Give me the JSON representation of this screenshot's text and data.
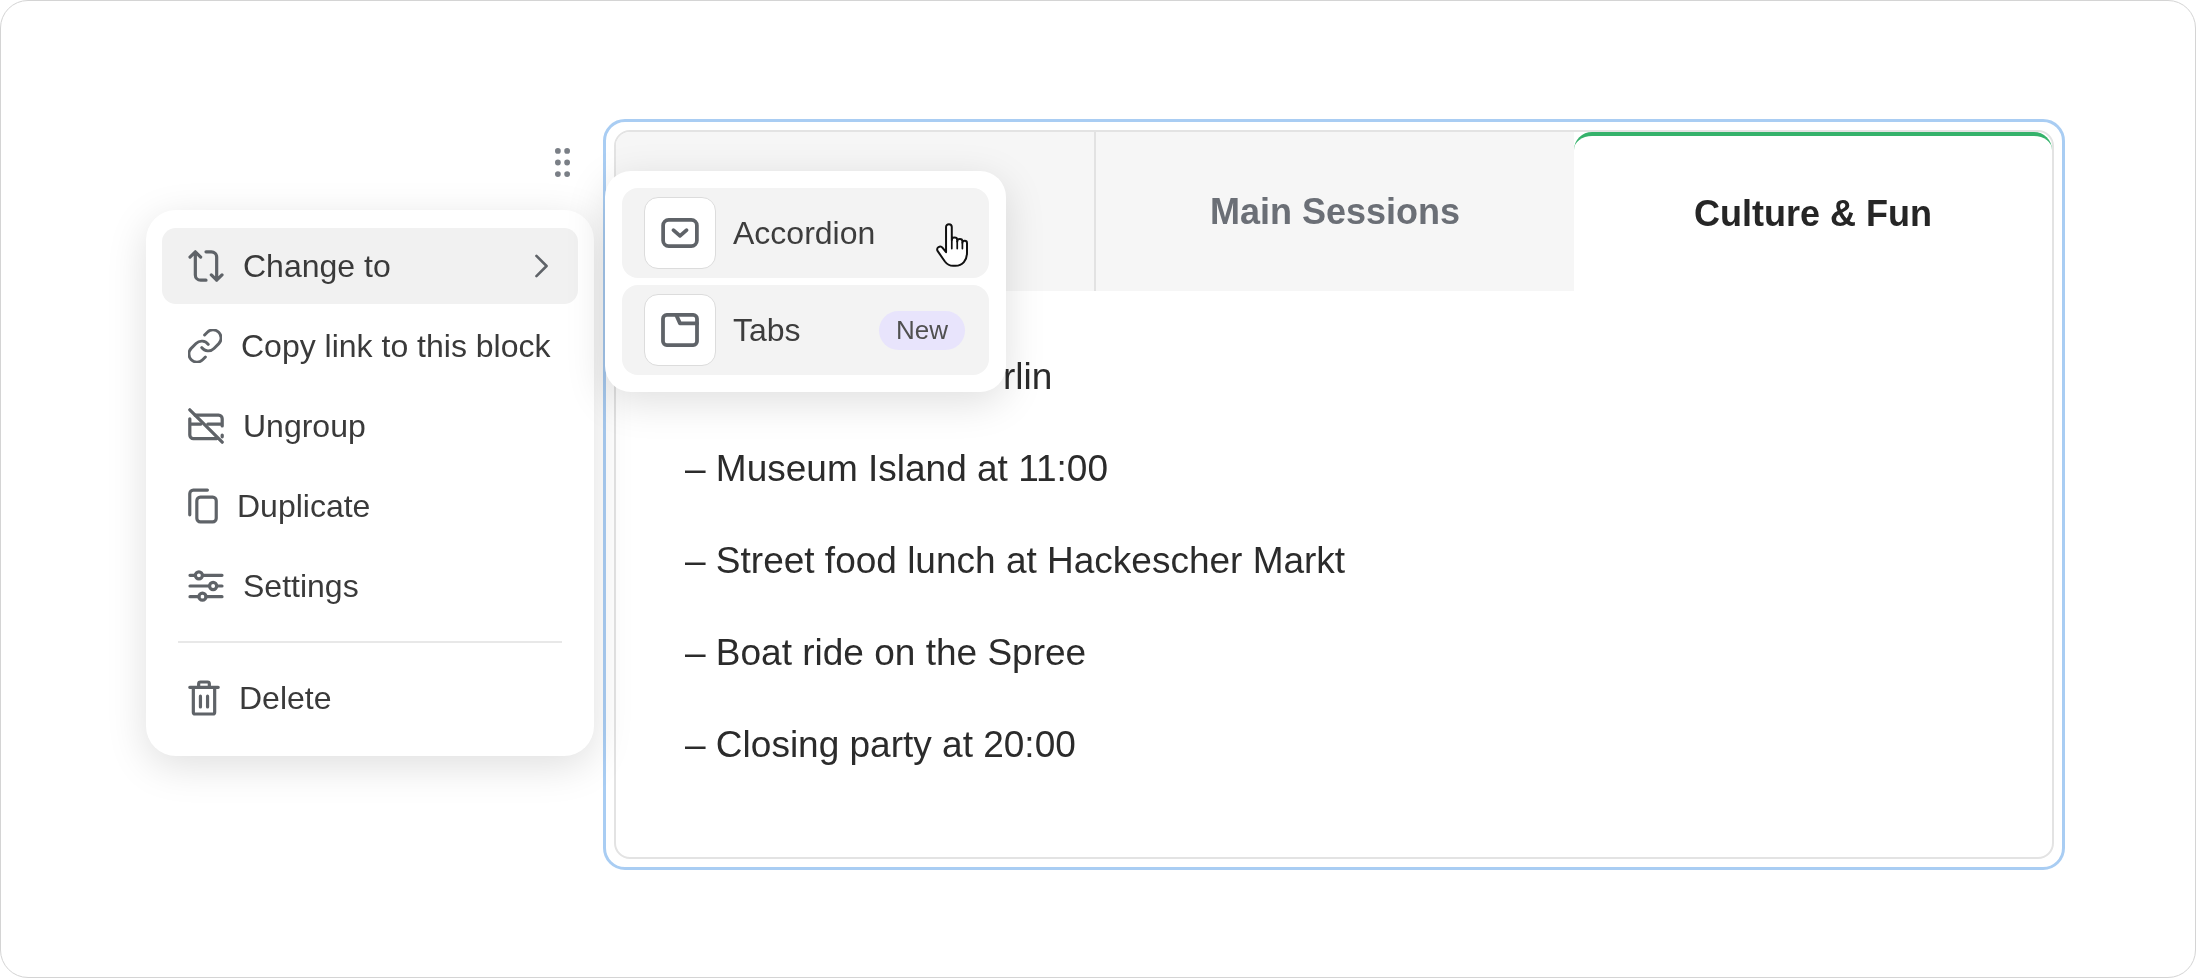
{
  "context_menu": {
    "sections": [
      {
        "items": [
          {
            "label": "Change to",
            "kind": "change",
            "highlighted": true
          },
          {
            "label": "Copy link to this block",
            "kind": "link",
            "highlighted": false
          },
          {
            "label": "Ungroup",
            "kind": "ungroup",
            "highlighted": false
          },
          {
            "label": "Duplicate",
            "kind": "duplicate",
            "highlighted": false
          },
          {
            "label": "Settings",
            "kind": "settings",
            "highlighted": false
          }
        ]
      },
      {
        "items": [
          {
            "label": "Delete",
            "kind": "delete",
            "highlighted": false
          }
        ]
      }
    ]
  },
  "submenu": {
    "items": [
      {
        "label": "Accordion",
        "kind": "accordion",
        "hovered": true
      },
      {
        "label": "Tabs",
        "kind": "tabs",
        "badge": "New",
        "hovered": false
      }
    ]
  },
  "tabs": [
    {
      "selected": false
    },
    {
      "label": "Main Sessions",
      "selected": false
    },
    {
      "label": "Culture & Fun",
      "selected": true
    }
  ],
  "tab_content": {
    "covered_line": "rlin",
    "lines": [
      "– Museum Island at 11:00",
      "– Street food lunch at Hackescher Markt",
      "– Boat ride on the Spree",
      "– Closing party at 20:00"
    ]
  }
}
